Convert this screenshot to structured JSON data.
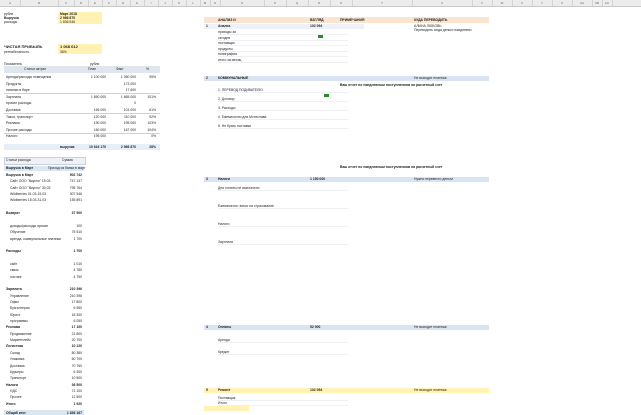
{
  "columns": [
    "A",
    "B",
    "C",
    "D",
    "E",
    "F",
    "G",
    "H",
    "I",
    "J",
    "K",
    "L",
    "M",
    "N",
    "O",
    "P",
    "Q",
    "R",
    "S",
    "T",
    "U",
    "V",
    "W",
    "X",
    "Y",
    "Z",
    "AA",
    "AB",
    "AC"
  ],
  "left": {
    "top_rows": [
      {
        "label": "рубли",
        "value": "Март 2018"
      },
      {
        "label": "Выручка",
        "value": "2 966 870"
      },
      {
        "label": "расходы",
        "value": "1 836 546"
      }
    ],
    "profit": {
      "label": "ЧИСТАЯ ПРИБЫЛЬ",
      "value": "1 068 612",
      "sublabel": "рентабельность",
      "subvalue": "36%"
    },
    "table1": {
      "title": "Показатель",
      "unit": "рубли",
      "headers": [
        "Статья затрат",
        "План",
        "Факт",
        "%"
      ],
      "rows": [
        [
          "Аренда/расходы помещения",
          "1 100 000",
          "1 050 000",
          "95%"
        ],
        [
          "Продукты",
          "",
          "173 000",
          ""
        ],
        [
          "напитки в баре",
          "",
          "17 600",
          ""
        ],
        [
          "Зарплата",
          "1 650 000",
          "1 665 000",
          "101%"
        ],
        [
          "прочие расходы",
          "",
          "0",
          ""
        ],
        [
          "Доставка",
          "165 000",
          "101 000",
          "61%"
        ],
        [
          "Такси, транспорт",
          "120 000",
          "110 000",
          "92%"
        ],
        [
          "Реклама",
          "190 000",
          "195 000",
          "103%"
        ],
        [
          "Прочие расходы",
          "160 000",
          "167 000",
          "104%"
        ],
        [
          "Налоги",
          "195 000",
          "",
          "0%"
        ]
      ],
      "total": {
        "label": "выручка",
        "v1": "10 616 170",
        "v2": "2 966 870",
        "pct": "28%"
      }
    },
    "table2": {
      "header_left": "Статьи расхода",
      "header_right": "Сумма",
      "title": "Выручка в Март",
      "title_right": "Приход из банка в март",
      "rows": [
        [
          "Выручка в Март",
          "902 742"
        ],
        [
          "Сайт ООО \"Вкусно\" 15.03",
          "747 137"
        ],
        [
          "Сайт ООО \"Вкусно\" 30.03",
          "795 764"
        ],
        [
          "Wildberries 01.03-15.03",
          "307 546"
        ],
        [
          "Wildberries 15.03-31.03",
          "155 891"
        ],
        [
          "",
          ""
        ],
        [
          "Возврат",
          "37 500"
        ],
        [
          "",
          ""
        ],
        [
          "доходы/расходы прочие",
          "100"
        ],
        [
          "Обучение",
          "75 510"
        ],
        [
          "аренда, коммунальные платежи",
          "1 700"
        ],
        [
          "",
          ""
        ],
        [
          "Расходы",
          "1 700"
        ],
        [
          "",
          ""
        ],
        [
          "сайт",
          "1 010"
        ],
        [
          "связь",
          "4 780"
        ],
        [
          "хостинг",
          "4 790"
        ],
        [
          "",
          ""
        ],
        [
          "Зарплата",
          "210 396"
        ],
        [
          "Управление",
          "210 396"
        ],
        [
          "Офис",
          "17 800"
        ],
        [
          "Бухгалтерия",
          "6 550"
        ],
        [
          "Юрист",
          "18 300"
        ],
        [
          "программы",
          "6 050"
        ],
        [
          "Реклама",
          "17 100"
        ],
        [
          "Продвижение",
          "21 800"
        ],
        [
          "Маркетплейс",
          "20 700"
        ],
        [
          "Логистика",
          "10 120"
        ],
        [
          "Склад",
          "80 380"
        ],
        [
          "Упаковка",
          "60 700"
        ],
        [
          "Доставка",
          "70 760"
        ],
        [
          "Курьеры",
          "6 300"
        ],
        [
          "Транспорт",
          "10 500"
        ],
        [
          "Налоги",
          "36 500"
        ],
        [
          "НДС",
          "72 100"
        ],
        [
          "Прочее",
          "12 500"
        ],
        [
          "Итого",
          "1 920"
        ]
      ],
      "grand_total": {
        "label": "Общий итог",
        "value": "1 836 167"
      }
    }
  },
  "right": {
    "header": {
      "col1": "АНАЛИЗ И",
      "col2": "ВЗГЛЯД",
      "col3": "ПРИМЕЧАНИЯ",
      "col4": "КУДА ПЕРЕВОДИТЬ",
      "sub4": "АЛИНА ЛЮБОВЬ",
      "sub4b": "Переводить сюда деньги ежедневно"
    },
    "sections": [
      {
        "num": "1",
        "title": "Анализ",
        "val": "102 094",
        "lines": [
          "приходы за",
          "сегодня",
          "поставщик",
          "продукты",
          "полиграфия",
          "итого за месяц"
        ]
      },
      {
        "num": "2",
        "title": "КОММУНАЛЬНЫЕ",
        "val": "",
        "note": "Не выходит платежа",
        "lines": [
          "1. ПЕРЕВОД ПОДИВАТЕЛЮ",
          "2. Договор",
          "3. Расходы",
          "4. Ежемесячно для Мстислава",
          "5. Не брать поставки"
        ]
      },
      {
        "num": "3",
        "title": "Налоги",
        "val": "1 150 000",
        "note": "Нужно перевести деньги",
        "lines": [
          "Для оплаты не выплачено",
          "Ежемесячно: взнос на страхование",
          "Налоги",
          "Зарплата"
        ]
      },
      {
        "num": "4",
        "title": "Оплаты",
        "val": "52 000",
        "note": "Не выходит платежа",
        "lines": [
          "Аренда",
          "Кредит"
        ]
      },
      {
        "num": "5",
        "title": "Ремонт",
        "val": "102 094",
        "note": "Не выходит платежа",
        "lines": [
          "Поставщик",
          "Итого"
        ]
      }
    ],
    "note_green": "Ваш отчет по ежедневным поступлениям на расчетный счет",
    "note_blue": "Ваш отчет по ежедневным поступлениям на расчетный счет"
  },
  "colors": {
    "yellow": "#fff2b3",
    "green": "#2a8a2a",
    "blue_band": "#d9e4f2",
    "orange_band": "#fbe4d0",
    "light_yellow": "#fff8d9"
  }
}
